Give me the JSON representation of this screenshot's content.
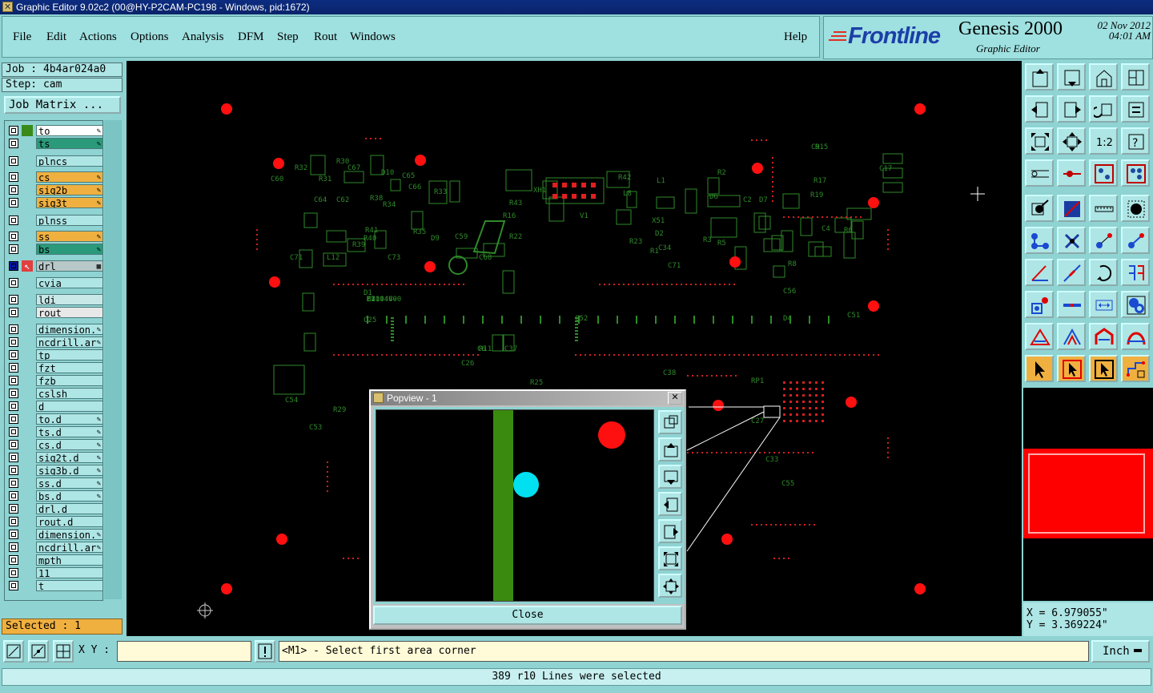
{
  "window": {
    "title": "Graphic Editor 9.02c2 (00@HY-P2CAM-PC198 - Windows, pid:1672)"
  },
  "menu": {
    "items": [
      "File",
      "Edit",
      "Actions",
      "Options",
      "Analysis",
      "DFM",
      "Step",
      "Rout",
      "Windows"
    ],
    "help": "Help"
  },
  "brand": {
    "logo": "Frontline",
    "product": "Genesis 2000",
    "subtitle": "Graphic Editor",
    "date": "02 Nov 2012",
    "time": "04:01 AM"
  },
  "job": {
    "job_label": "Job : 4b4ar024a0",
    "step_label": "Step: cam",
    "matrix_button": "Job Matrix ..."
  },
  "layers": [
    {
      "name": "to",
      "color": "#3a8a1a",
      "bg": "#ffffff",
      "mark": "✎"
    },
    {
      "name": "ts",
      "color": "#8fd3d3",
      "bg": "#2a9a7a",
      "mark": "✎"
    },
    {
      "name": "plncs",
      "color": "#8fd3d3",
      "bg": "#aee5e5",
      "mark": ""
    },
    {
      "name": "cs",
      "color": "#8fd3d3",
      "bg": "#f0b040",
      "mark": "✎"
    },
    {
      "name": "sig2b",
      "color": "#8fd3d3",
      "bg": "#f0b040",
      "mark": "✎"
    },
    {
      "name": "sig3t",
      "color": "#8fd3d3",
      "bg": "#f0b040",
      "mark": "✎"
    },
    {
      "name": "plnss",
      "color": "#8fd3d3",
      "bg": "#aee5e5",
      "mark": ""
    },
    {
      "name": "ss",
      "color": "#8fd3d3",
      "bg": "#f0b040",
      "mark": "✎"
    },
    {
      "name": "bs",
      "color": "#8fd3d3",
      "bg": "#2a9a7a",
      "mark": "✎"
    },
    {
      "name": "drl",
      "color": "#e04040",
      "bg": "#b8c8c8",
      "mark": "▦"
    },
    {
      "name": "cvia",
      "color": "#8fd3d3",
      "bg": "#aee5e5",
      "mark": ""
    },
    {
      "name": "ldi",
      "color": "#8fd3d3",
      "bg": "#c8e8e8",
      "mark": ""
    },
    {
      "name": "rout",
      "color": "#8fd3d3",
      "bg": "#e8e8e8",
      "mark": ""
    },
    {
      "name": "dimension.",
      "color": "#8fd3d3",
      "bg": "#aee5e5",
      "mark": "✎"
    },
    {
      "name": "ncdrill.ar",
      "color": "#8fd3d3",
      "bg": "#aee5e5",
      "mark": "✎"
    },
    {
      "name": "tp",
      "color": "#8fd3d3",
      "bg": "#aee5e5",
      "mark": ""
    },
    {
      "name": "fzt",
      "color": "#8fd3d3",
      "bg": "#aee5e5",
      "mark": ""
    },
    {
      "name": "fzb",
      "color": "#8fd3d3",
      "bg": "#aee5e5",
      "mark": ""
    },
    {
      "name": "cslsh",
      "color": "#8fd3d3",
      "bg": "#aee5e5",
      "mark": ""
    },
    {
      "name": "d",
      "color": "#8fd3d3",
      "bg": "#aee5e5",
      "mark": ""
    },
    {
      "name": "to.d",
      "color": "#8fd3d3",
      "bg": "#aee5e5",
      "mark": "✎"
    },
    {
      "name": "ts.d",
      "color": "#8fd3d3",
      "bg": "#aee5e5",
      "mark": "✎"
    },
    {
      "name": "cs.d",
      "color": "#8fd3d3",
      "bg": "#aee5e5",
      "mark": "✎"
    },
    {
      "name": "sig2t.d",
      "color": "#8fd3d3",
      "bg": "#aee5e5",
      "mark": "✎"
    },
    {
      "name": "sig3b.d",
      "color": "#8fd3d3",
      "bg": "#aee5e5",
      "mark": "✎"
    },
    {
      "name": "ss.d",
      "color": "#8fd3d3",
      "bg": "#aee5e5",
      "mark": "✎"
    },
    {
      "name": "bs.d",
      "color": "#8fd3d3",
      "bg": "#aee5e5",
      "mark": "✎"
    },
    {
      "name": "drl.d",
      "color": "#8fd3d3",
      "bg": "#aee5e5",
      "mark": ""
    },
    {
      "name": "rout.d",
      "color": "#8fd3d3",
      "bg": "#aee5e5",
      "mark": ""
    },
    {
      "name": "dimension.",
      "color": "#8fd3d3",
      "bg": "#aee5e5",
      "mark": "✎"
    },
    {
      "name": "ncdrill.ar",
      "color": "#8fd3d3",
      "bg": "#aee5e5",
      "mark": "✎"
    },
    {
      "name": "mpth",
      "color": "#8fd3d3",
      "bg": "#aee5e5",
      "mark": ""
    },
    {
      "name": "11",
      "color": "#8fd3d3",
      "bg": "#aee5e5",
      "mark": ""
    },
    {
      "name": "t",
      "color": "#8fd3d3",
      "bg": "#aee5e5",
      "mark": ""
    }
  ],
  "selection": {
    "label": "Selected : 1"
  },
  "board_labels": [
    "R30",
    "R32",
    "C67",
    "D10",
    "C65",
    "C66",
    "R33",
    "R43",
    "XH1",
    "R42",
    "L1",
    "L8",
    "R2",
    "C2",
    "C9",
    "R15",
    "R17",
    "R19",
    "C17",
    "C60",
    "R31",
    "C64",
    "C62",
    "R38",
    "R34",
    "R35",
    "D9",
    "C59",
    "C68",
    "R41",
    "R40",
    "R39",
    "L12",
    "C73",
    "C71",
    "D1",
    "C25",
    "C26",
    "C6",
    "R11",
    "C37",
    "R25",
    "C38",
    "C32",
    "RP1",
    "C27",
    "C33",
    "C55",
    "C56",
    "D4",
    "C51",
    "C52",
    "C53",
    "C54",
    "R29",
    "V1",
    "R23",
    "X51",
    "D2",
    "R1",
    "C34",
    "C71",
    "R3",
    "R5",
    "C4",
    "R6",
    "R8",
    "D6",
    "D7",
    "R16",
    "R22",
    "C11",
    "L2",
    "C7",
    "C8",
    "E204460",
    "M1 94V-0"
  ],
  "coords": {
    "x": "X = 6.979055\"",
    "y": "Y = 3.369224\""
  },
  "popview": {
    "title": "Popview - 1",
    "close_label": "Close"
  },
  "bottom": {
    "xy_label": "X Y :",
    "xy_value": "",
    "prompt": "<M1> - Select first area corner",
    "unit": "Inch",
    "status": "389 r10 Lines were selected"
  },
  "toolbar_icons": [
    "open-job-icon",
    "save-icon",
    "home-icon",
    "split-window-icon",
    "move-left-icon",
    "move-right-icon",
    "undo-icon",
    "redraw-icon",
    "zoom-fit-icon",
    "zoom-center-icon",
    "scale-1-2-icon",
    "help-icon",
    "snap-icon",
    "measure-icon",
    "layers-active-icon",
    "layers-all-icon",
    "pad-icon",
    "line-icon",
    "ruler-icon",
    "hole-icon",
    "connect-icon",
    "cross-icon",
    "arrow-pad-icon",
    "arrow-pad2-icon",
    "angle-icon",
    "slash-icon",
    "rotate-icon",
    "mirror-icon",
    "pad-select-icon",
    "bar-icon",
    "dimension-icon",
    "pads-icon",
    "triangle-icon",
    "triangle2-icon",
    "arch-icon",
    "arch2-icon",
    "pointer-icon",
    "pointer-box-icon",
    "pointer-box2-icon",
    "route-icon"
  ]
}
